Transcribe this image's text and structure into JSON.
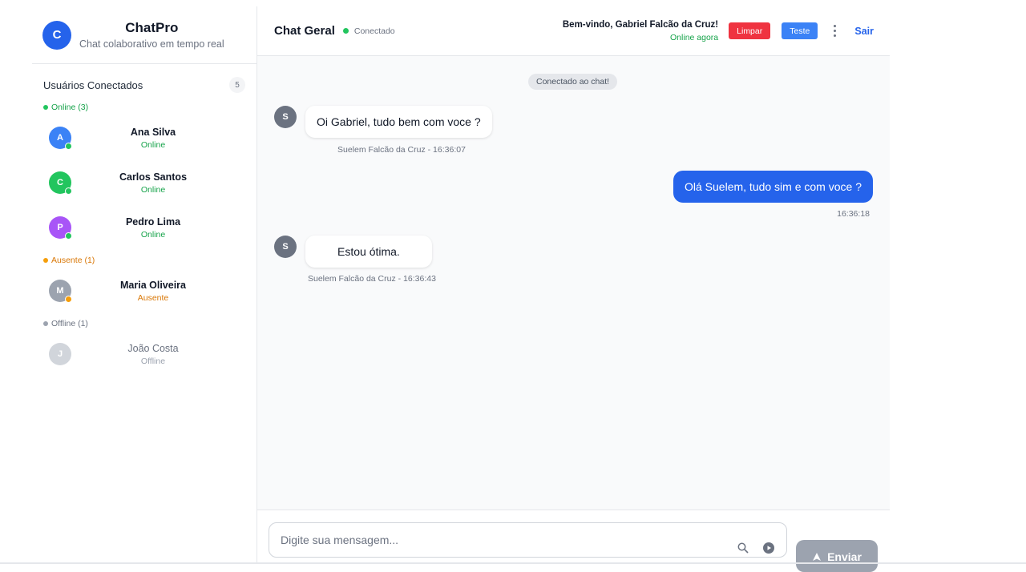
{
  "brand": {
    "logo_letter": "C",
    "title": "ChatPro",
    "subtitle": "Chat colaborativo em tempo real"
  },
  "sidebar": {
    "users_title": "Usuários Conectados",
    "users_count": "5",
    "groups": [
      {
        "label": "Online (3)",
        "color": "#16a34a",
        "users": [
          {
            "initial": "A",
            "name": "Ana Silva",
            "status": "Online",
            "avatar_color": "#3b82f6"
          },
          {
            "initial": "C",
            "name": "Carlos Santos",
            "status": "Online",
            "avatar_color": "#22c55e"
          },
          {
            "initial": "P",
            "name": "Pedro Lima",
            "status": "Online",
            "avatar_color": "#a855f7"
          }
        ]
      },
      {
        "label": "Ausente (1)",
        "color": "#d97706",
        "users": [
          {
            "initial": "M",
            "name": "Maria Oliveira",
            "status": "Ausente",
            "avatar_color": "#9ca3af"
          }
        ]
      },
      {
        "label": "Offline (1)",
        "color": "#6b7280",
        "users": [
          {
            "initial": "J",
            "name": "João Costa",
            "status": "Offline",
            "avatar_color": "#d1d5db"
          }
        ]
      }
    ]
  },
  "header": {
    "chat_title": "Chat Geral",
    "connection_status": "Conectado",
    "welcome": "Bem-vindo, Gabriel Falcão da Cruz!",
    "presence": "Online agora",
    "clear_label": "Limpar",
    "test_label": "Teste",
    "menu_icon": "more-vertical-icon",
    "logout_label": "Sair"
  },
  "messages": {
    "system": "Conectado ao chat!",
    "items": [
      {
        "direction": "in",
        "avatar": "S",
        "text": "Oi Gabriel, tudo bem com voce ?",
        "meta": "Suelem Falcão da Cruz - 16:36:07"
      },
      {
        "direction": "out",
        "text": "Olá Suelem, tudo sim e com voce ?",
        "meta": "16:36:18"
      },
      {
        "direction": "in",
        "avatar": "S",
        "text": "Estou ótima.",
        "meta": "Suelem Falcão da Cruz - 16:36:43"
      }
    ]
  },
  "composer": {
    "placeholder": "Digite sua mensagem...",
    "search_icon": "search-icon",
    "record_icon": "record-icon",
    "send_icon": "arrow-up-icon",
    "send_label": "Enviar"
  },
  "colors": {
    "accent": "#2563eb",
    "danger": "#ef3340",
    "online": "#22c55e",
    "away": "#f59e0b"
  }
}
